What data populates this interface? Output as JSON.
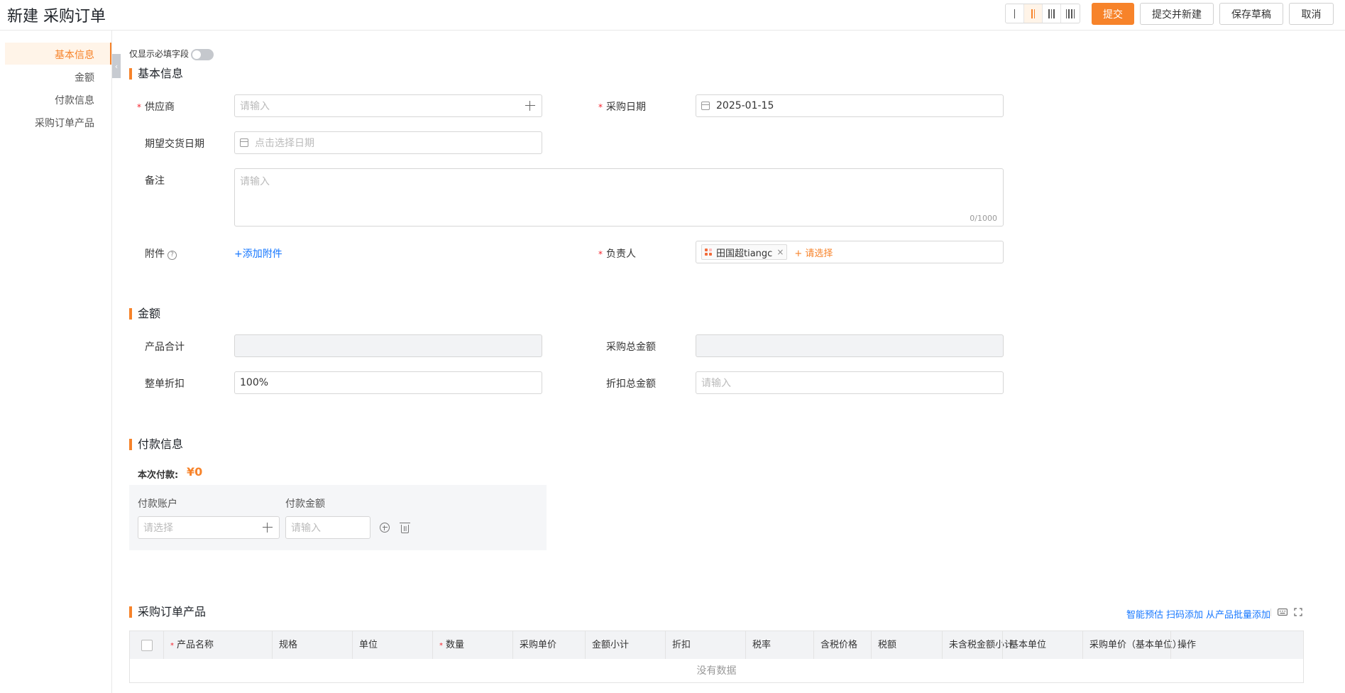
{
  "header": {
    "title": "新建 采购订单",
    "buttons": {
      "submit": "提交",
      "submit_new": "提交并新建",
      "save_draft": "保存草稿",
      "cancel": "取消"
    }
  },
  "sidebar": {
    "items": [
      "基本信息",
      "金额",
      "付款信息",
      "采购订单产品"
    ],
    "active": "基本信息"
  },
  "toggle_label": "仅显示必填字段",
  "basic": {
    "title": "基本信息",
    "supplier_label": "供应商",
    "supplier_placeholder": "请输入",
    "purchase_date_label": "采购日期",
    "purchase_date_value": "2025-01-15",
    "delivery_date_label": "期望交货日期",
    "delivery_date_placeholder": "点击选择日期",
    "remark_label": "备注",
    "remark_placeholder": "请输入",
    "remark_counter": "0/1000",
    "attachment_label": "附件",
    "attachment_help": "?",
    "add_attachment": "+添加附件",
    "owner_label": "负责人",
    "owner_tag": "田国超tiangc",
    "owner_tag_close": "×",
    "owner_add": "+ 请选择"
  },
  "amount": {
    "title": "金额",
    "product_total_label": "产品合计",
    "purchase_total_label": "采购总金额",
    "discount_label": "整单折扣",
    "discount_value": "100%",
    "discount_total_label": "折扣总金额",
    "discount_total_placeholder": "请输入"
  },
  "payment": {
    "title": "付款信息",
    "this_payment_label": "本次付款:",
    "this_payment_value": "¥0",
    "account_label": "付款账户",
    "account_placeholder": "请选择",
    "amount_label": "付款金额",
    "amount_placeholder": "请输入"
  },
  "products": {
    "title": "采购订单产品",
    "tools": {
      "smart_estimate": "智能预估",
      "scan_add": "扫码添加",
      "batch_add": "从产品批量添加"
    },
    "columns": [
      {
        "label": "产品名称",
        "required": true
      },
      {
        "label": "规格",
        "required": false
      },
      {
        "label": "单位",
        "required": false
      },
      {
        "label": "数量",
        "required": true
      },
      {
        "label": "采购单价",
        "required": false
      },
      {
        "label": "金额小计",
        "required": false
      },
      {
        "label": "折扣",
        "required": false
      },
      {
        "label": "税率",
        "required": false
      },
      {
        "label": "含税价格",
        "required": false
      },
      {
        "label": "税额",
        "required": false
      },
      {
        "label": "未含税金额小计",
        "required": false
      },
      {
        "label": "基本单位",
        "required": false
      },
      {
        "label": "采购单价（基本单位）",
        "required": false
      },
      {
        "label": "操作",
        "required": false
      }
    ],
    "empty_text": "没有数据"
  },
  "colors": {
    "accent": "#f7832a",
    "link": "#1677ff",
    "required": "#f5222d"
  }
}
